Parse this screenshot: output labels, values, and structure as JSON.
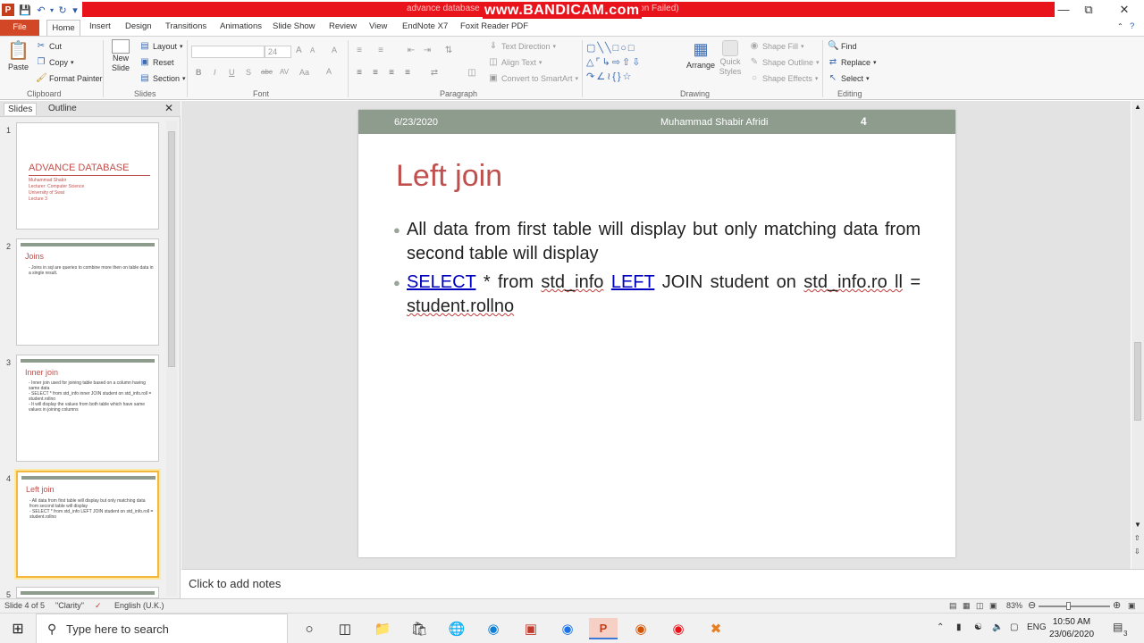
{
  "window": {
    "doc_title": "advance database - Microsoft PowerPoint (Product Activation Failed)",
    "watermark": "www.BANDICAM.com",
    "app_icon": "P"
  },
  "tabs": [
    "File",
    "Home",
    "Insert",
    "Design",
    "Transitions",
    "Animations",
    "Slide Show",
    "Review",
    "View",
    "EndNote X7",
    "Foxit Reader PDF"
  ],
  "ribbon": {
    "clipboard": {
      "paste": "Paste",
      "cut": "Cut",
      "copy": "Copy",
      "format_painter": "Format Painter",
      "label": "Clipboard"
    },
    "slides": {
      "new_slide": "New Slide",
      "layout": "Layout",
      "reset": "Reset",
      "section": "Section",
      "label": "Slides"
    },
    "font": {
      "size": "24",
      "label": "Font",
      "bold": "B",
      "italic": "I",
      "underline": "U",
      "strike": "S",
      "shadow": "abc",
      "spacing": "AV",
      "case": "Aa",
      "color": "A",
      "grow": "A",
      "shrink": "A",
      "clear": "A"
    },
    "paragraph": {
      "text_direction": "Text Direction",
      "align_text": "Align Text",
      "smartart": "Convert to SmartArt",
      "label": "Paragraph"
    },
    "drawing": {
      "arrange": "Arrange",
      "quick_styles": "Quick Styles",
      "shape_fill": "Shape Fill",
      "shape_outline": "Shape Outline",
      "shape_effects": "Shape Effects",
      "label": "Drawing"
    },
    "editing": {
      "find": "Find",
      "replace": "Replace",
      "select": "Select",
      "label": "Editing"
    }
  },
  "panel": {
    "tab_slides": "Slides",
    "tab_outline": "Outline"
  },
  "thumbs": [
    {
      "num": "1",
      "title": "ADVANCE DATABASE",
      "lines": [
        "Muhammad Shabir",
        "Lecturer: Computer Science",
        "University of Swat",
        "Lecture 3"
      ]
    },
    {
      "num": "2",
      "title": "Joins",
      "lines": [
        "- Joins in sql are queries to combine more then on table data in a single result."
      ]
    },
    {
      "num": "3",
      "title": "Inner join",
      "lines": [
        "- Inner join used for joining table based on a column having same data",
        "- SELECT * from std_info inner JOIN student on std_info.roll = student.rollno",
        "- It will display the values from both table which have same values in joining columns"
      ]
    },
    {
      "num": "4",
      "title": "Left join",
      "lines": [
        "- All data from first table will display but only matching data from second table will display",
        "- SELECT * from std_info LEFT JOIN student on std_info.roll = student.rollno"
      ]
    },
    {
      "num": "5"
    }
  ],
  "slide": {
    "date": "6/23/2020",
    "author": "Muhammad  Shabir Afridi",
    "number": "4",
    "title": "Left join",
    "bullet1": "All data from first table will display but only matching data from second table will display",
    "b2": {
      "kw1": "SELECT",
      "t1": " * from ",
      "w1": "std_info",
      "sp": " ",
      "kw2": "LEFT",
      "t2": " JOIN student on ",
      "w2": "std_info.ro ll",
      "t3": " = ",
      "w3": "student.rollno"
    }
  },
  "notes_placeholder": "Click to add notes",
  "status": {
    "slide": "Slide 4 of 5",
    "theme": "\"Clarity\"",
    "language": "English (U.K.)",
    "zoom": "83%"
  },
  "taskbar": {
    "search_placeholder": "Type here to search",
    "lang": "ENG",
    "time": "10:50 AM",
    "date": "23/06/2020",
    "notif": "3"
  }
}
